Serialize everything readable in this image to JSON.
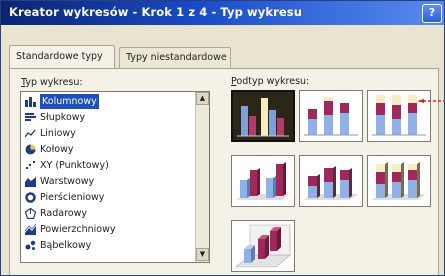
{
  "window": {
    "title": "Kreator wykresów - Krok 1 z 4 - Typ wykresu",
    "help_label": "?"
  },
  "tabs": [
    {
      "label": "Standardowe typy",
      "active": true
    },
    {
      "label": "Typy niestandardowe",
      "active": false
    }
  ],
  "chart_type": {
    "label_prefix": "T",
    "label_rest": "yp wykresu:",
    "items": [
      {
        "label": "Kolumnowy",
        "icon": "column-chart-icon",
        "selected": true
      },
      {
        "label": "Słupkowy",
        "icon": "bar-chart-icon",
        "selected": false
      },
      {
        "label": "Liniowy",
        "icon": "line-chart-icon",
        "selected": false
      },
      {
        "label": "Kołowy",
        "icon": "pie-chart-icon",
        "selected": false
      },
      {
        "label": "XY (Punktowy)",
        "icon": "scatter-chart-icon",
        "selected": false
      },
      {
        "label": "Warstwowy",
        "icon": "area-chart-icon",
        "selected": false
      },
      {
        "label": "Pierścieniowy",
        "icon": "doughnut-chart-icon",
        "selected": false
      },
      {
        "label": "Radarowy",
        "icon": "radar-chart-icon",
        "selected": false
      },
      {
        "label": "Powierzchniowy",
        "icon": "surface-chart-icon",
        "selected": false
      },
      {
        "label": "Bąbelkowy",
        "icon": "bubble-chart-icon",
        "selected": false
      }
    ],
    "scroll_up": "▲",
    "scroll_down": "▼"
  },
  "subtype": {
    "label_prefix": "P",
    "label_rest": "odtyp wykresu:",
    "thumbnails": [
      {
        "name": "clustered-column",
        "selected": true
      },
      {
        "name": "stacked-column",
        "selected": false
      },
      {
        "name": "100-stacked-column",
        "selected": false
      },
      {
        "name": "3d-clustered-column",
        "selected": false
      },
      {
        "name": "3d-stacked-column",
        "selected": false
      },
      {
        "name": "3d-100-stacked-column",
        "selected": false
      },
      {
        "name": "3d-column",
        "selected": false
      }
    ]
  },
  "colors": {
    "title_start": "#0a2470",
    "title_end": "#5a8cf0",
    "selection": "#1f4fb8",
    "series_blue": "#8fb1e6",
    "series_magenta": "#a0285a",
    "series_cream": "#f6edc2",
    "annotation_arrow": "#e11d1d"
  }
}
